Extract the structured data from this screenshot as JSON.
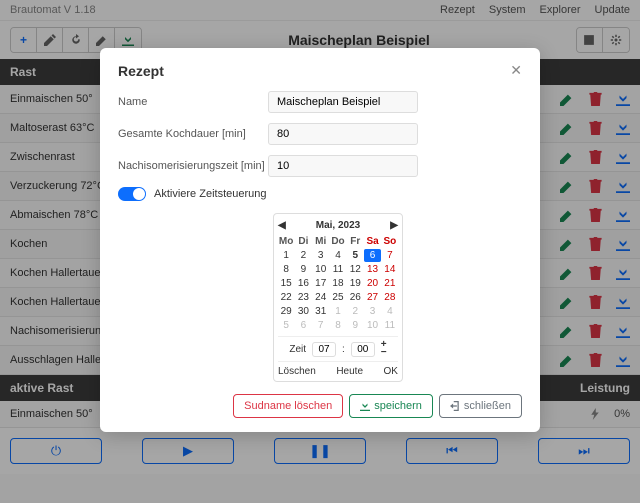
{
  "brand": "Brautomat V 1.18",
  "nav": {
    "rezept": "Rezept",
    "system": "System",
    "explorer": "Explorer",
    "update": "Update"
  },
  "toolbar": {
    "title": "Maischeplan Beispiel",
    "add": "+",
    "brush": "✎",
    "refresh": "↻",
    "edit": "✎",
    "download": "⬇"
  },
  "tableHeader": {
    "left": "Rast",
    "right": ""
  },
  "rows": [
    {
      "label": "Einmaischen 50°"
    },
    {
      "label": "Maltoserast 63°C"
    },
    {
      "label": "Zwischenrast"
    },
    {
      "label": "Verzuckerung 72°C"
    },
    {
      "label": "Abmaischen 78°C"
    },
    {
      "label": "Kochen"
    },
    {
      "label": "Kochen Hallertauer …"
    },
    {
      "label": "Kochen Hallertauer …"
    },
    {
      "label": "Nachisomerisierung …"
    },
    {
      "label": "Ausschlagen Hallert…"
    }
  ],
  "activeHeader": {
    "left": "aktive Rast",
    "right": "Leistung"
  },
  "activeRow": {
    "label": "Einmaischen 50°",
    "power": "0%"
  },
  "modal": {
    "title": "Rezept",
    "name_label": "Name",
    "name_value": "Maischeplan Beispiel",
    "dur_label": "Gesamte Kochdauer [min]",
    "dur_value": "80",
    "iso_label": "Nachisomerisierungszeit [min]",
    "iso_value": "10",
    "toggle_label": "Aktiviere Zeitsteuerung",
    "cal_title": "Mai, 2023",
    "dow": [
      "Mo",
      "Di",
      "Mi",
      "Do",
      "Fr",
      "Sa",
      "So"
    ],
    "weeks": [
      [
        {
          "d": "1"
        },
        {
          "d": "2"
        },
        {
          "d": "3"
        },
        {
          "d": "4"
        },
        {
          "d": "5",
          "today": true
        },
        {
          "d": "6",
          "sel": true,
          "sat": true
        },
        {
          "d": "7",
          "sun": true
        }
      ],
      [
        {
          "d": "8"
        },
        {
          "d": "9"
        },
        {
          "d": "10"
        },
        {
          "d": "11"
        },
        {
          "d": "12"
        },
        {
          "d": "13",
          "sat": true
        },
        {
          "d": "14",
          "sun": true
        }
      ],
      [
        {
          "d": "15"
        },
        {
          "d": "16"
        },
        {
          "d": "17"
        },
        {
          "d": "18"
        },
        {
          "d": "19"
        },
        {
          "d": "20",
          "sat": true
        },
        {
          "d": "21",
          "sun": true
        }
      ],
      [
        {
          "d": "22"
        },
        {
          "d": "23"
        },
        {
          "d": "24"
        },
        {
          "d": "25"
        },
        {
          "d": "26"
        },
        {
          "d": "27",
          "sat": true
        },
        {
          "d": "28",
          "sun": true
        }
      ],
      [
        {
          "d": "29"
        },
        {
          "d": "30"
        },
        {
          "d": "31"
        },
        {
          "d": "1",
          "muted": true
        },
        {
          "d": "2",
          "muted": true
        },
        {
          "d": "3",
          "muted": true,
          "sat": true
        },
        {
          "d": "4",
          "muted": true,
          "sun": true
        }
      ],
      [
        {
          "d": "5",
          "muted": true
        },
        {
          "d": "6",
          "muted": true
        },
        {
          "d": "7",
          "muted": true
        },
        {
          "d": "8",
          "muted": true
        },
        {
          "d": "9",
          "muted": true
        },
        {
          "d": "10",
          "muted": true,
          "sat": true
        },
        {
          "d": "11",
          "muted": true,
          "sun": true
        }
      ]
    ],
    "time_label": "Zeit",
    "hour": "07",
    "minute": "00",
    "cal_loeschen": "Löschen",
    "cal_heute": "Heute",
    "cal_ok": "OK",
    "btn_delete": "Sudname löschen",
    "btn_save": "speichern",
    "btn_close": "schließen"
  },
  "transport": {
    "power": "⏻",
    "play": "▶",
    "pause": "❚❚",
    "prev": "◀◀",
    "next": "▶▶"
  }
}
